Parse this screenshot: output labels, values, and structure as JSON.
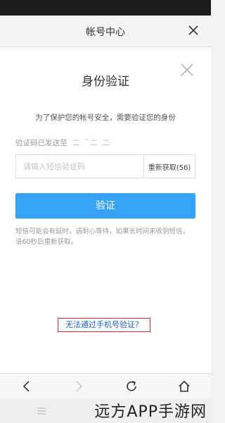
{
  "header": {
    "title": "帐号中心",
    "close_icon": "close-icon"
  },
  "dialog": {
    "heading": "身份验证",
    "description": "为了保护您的帐号安全，需要验证您的身份",
    "sent_to_label": "验证码已发送至",
    "sent_to_masked": "二 ˜二 二",
    "code_input": {
      "placeholder": "请输入短信验证码",
      "value": ""
    },
    "resend_label": "重新获取(56)",
    "verify_button": "验证",
    "note": "短信可能会有延时，请耐心等待，如果长时间未收到短信，请60秒后重新获取。",
    "alt_link": "无法通过手机号验证？"
  },
  "browser_nav": {
    "items": [
      "back-icon",
      "forward-icon",
      "refresh-icon",
      "home-icon"
    ]
  },
  "watermark": "远方APP手游网",
  "colors": {
    "accent": "#38a2f5",
    "link": "#2262c8",
    "highlight_border": "#cc3333"
  }
}
